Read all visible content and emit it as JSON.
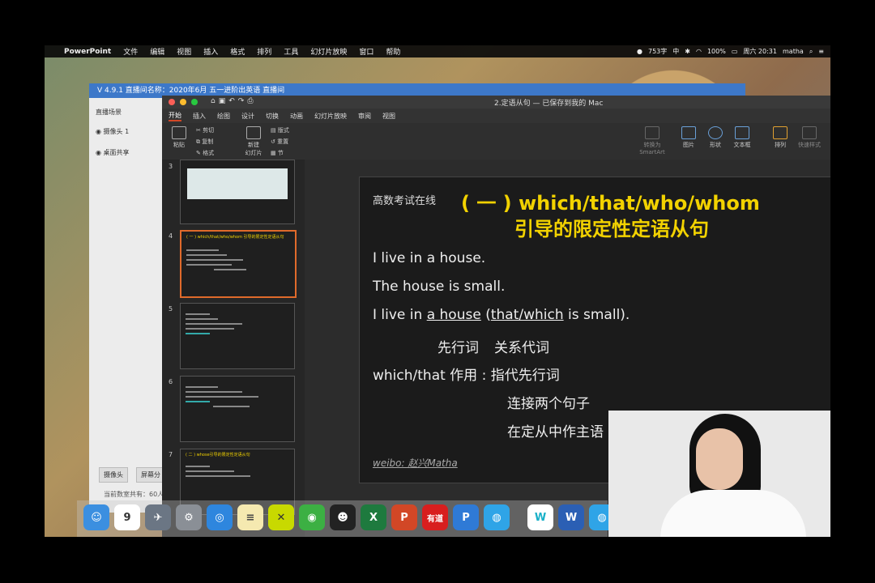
{
  "menubar": {
    "apple_icon": "",
    "app_name": "PowerPoint",
    "items": [
      "文件",
      "编辑",
      "视图",
      "插入",
      "格式",
      "排列",
      "工具",
      "幻灯片放映",
      "窗口",
      "帮助"
    ],
    "status": {
      "word_count": "753字",
      "input": "中",
      "battery": "100%",
      "datetime": "周六 20:31",
      "user": "matha"
    }
  },
  "obs": {
    "title": "V 4.9.1  直播间名称：2020年6月 五一进阶出英语 直播间",
    "scenes_header": "直播场景",
    "sources": [
      "摄像头 1",
      "桌面共享"
    ],
    "buttons": [
      "摄像头",
      "屏幕分"
    ],
    "total": "当前数室共有：60人"
  },
  "powerpoint": {
    "doc_title": "2.定语从句 — 已保存到我的 Mac",
    "tabs": [
      "开始",
      "插入",
      "绘图",
      "设计",
      "切换",
      "动画",
      "幻灯片放映",
      "审阅",
      "视图"
    ],
    "ribbon": {
      "paste": "粘贴",
      "cut": "剪切",
      "copy": "复制",
      "format": "格式",
      "new_slide": "新建\n幻灯片",
      "layout": "版式",
      "reset": "重置",
      "section": "节",
      "convert": "转换为\nSmartArt",
      "picture": "图片",
      "shape": "形状",
      "textbox": "文本框",
      "arrange": "排列",
      "quick_style": "快速样式"
    },
    "thumbnails": [
      {
        "num": "3",
        "title": ""
      },
      {
        "num": "4",
        "title": "( 一 ) which/that/who/whom 引导的限定性定语从句"
      },
      {
        "num": "5",
        "title": ""
      },
      {
        "num": "6",
        "title": ""
      },
      {
        "num": "7",
        "title": "( 二 ) whose引导的限定性定语从句"
      }
    ],
    "slide": {
      "logo": "高数考试在线",
      "title_line1": "( 一 ) which/that/who/whom",
      "title_line2": "引导的限定性定语从句",
      "line1": "I live in a house.",
      "line2": "The house is small.",
      "line3_a": "I live in ",
      "line3_u1": "a house",
      "line3_b": " (",
      "line3_u2": "that/which",
      "line3_c": " is small).",
      "label1": "先行词",
      "label2": "关系代词",
      "role_label": "which/that 作用 : 指代先行词",
      "role2": "连接两个句子",
      "role3": "在定从中作主语",
      "weibo": "weibo: 赵兴Matha"
    }
  },
  "dock_apps": [
    "Finder",
    "日历",
    "Launchpad",
    "系统偏好设置",
    "Safari",
    "备忘录",
    "xmind",
    "微信",
    "QQ",
    "Excel",
    "PowerPoint",
    "有道",
    "P",
    "Zoom",
    "W",
    "Word",
    "会议"
  ],
  "colors": {
    "accent_yellow": "#f2d200",
    "selection": "#e06a2b",
    "titlebar_blue": "#3d78c9"
  }
}
